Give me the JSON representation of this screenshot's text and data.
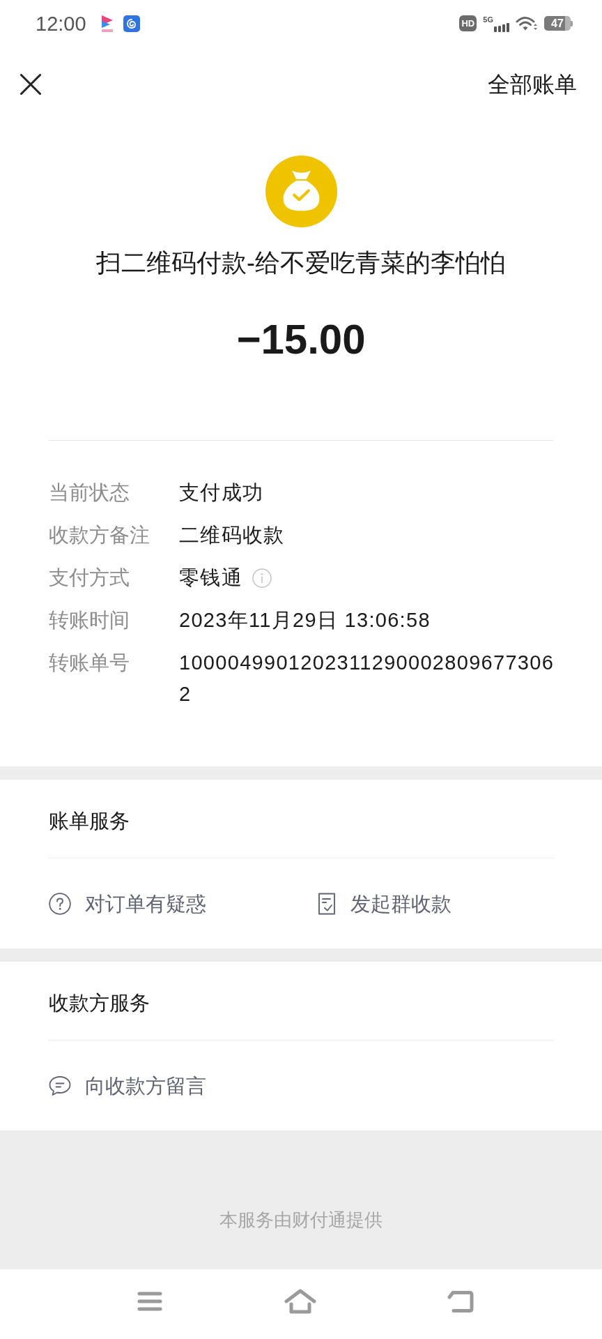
{
  "status_bar": {
    "time": "12:00",
    "hd_label": "HD",
    "network": "5G",
    "battery": "47"
  },
  "header": {
    "action": "全部账单"
  },
  "summary": {
    "title": "扫二维码付款-给不爱吃青菜的李怕怕",
    "amount": "−15.00"
  },
  "details": [
    {
      "label": "当前状态",
      "value": "支付成功",
      "info": false
    },
    {
      "label": "收款方备注",
      "value": "二维码收款",
      "info": false
    },
    {
      "label": "支付方式",
      "value": "零钱通",
      "info": true
    },
    {
      "label": "转账时间",
      "value": "2023年11月29日 13:06:58",
      "info": false
    },
    {
      "label": "转账单号",
      "value": "10000499012023112900028096773062",
      "info": false
    }
  ],
  "sections": [
    {
      "heading": "账单服务",
      "items": [
        {
          "kind": "question",
          "label": "对订单有疑惑"
        },
        {
          "kind": "bill",
          "label": "发起群收款"
        }
      ]
    },
    {
      "heading": "收款方服务",
      "items": [
        {
          "kind": "message",
          "label": "向收款方留言"
        }
      ]
    }
  ],
  "footer": {
    "note": "本服务由财付通提供"
  }
}
